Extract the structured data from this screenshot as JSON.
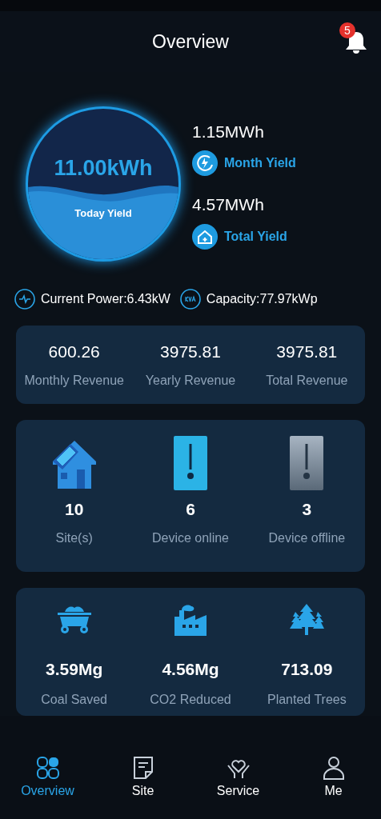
{
  "header": {
    "title": "Overview",
    "notification_count": "5"
  },
  "today": {
    "value": "11.00kWh",
    "label": "Today Yield"
  },
  "yields": [
    {
      "kind": "month",
      "value": "1.15MWh",
      "label": "Month Yield"
    },
    {
      "kind": "total",
      "value": "4.57MWh",
      "label": "Total Yield"
    }
  ],
  "stats": [
    {
      "kind": "power",
      "text": "Current Power:6.43kW"
    },
    {
      "kind": "capacity",
      "text": "Capacity:77.97kWp"
    }
  ],
  "revenue": [
    {
      "value": "600.26",
      "label": "Monthly Revenue"
    },
    {
      "value": "3975.81",
      "label": "Yearly Revenue"
    },
    {
      "value": "3975.81",
      "label": "Total Revenue"
    }
  ],
  "devices": [
    {
      "kind": "site",
      "value": "10",
      "label": "Site(s)"
    },
    {
      "kind": "online",
      "value": "6",
      "label": "Device online"
    },
    {
      "kind": "offline",
      "value": "3",
      "label": "Device offline"
    }
  ],
  "environment": [
    {
      "kind": "coal",
      "value": "3.59Mg",
      "label": "Coal Saved"
    },
    {
      "kind": "co2",
      "value": "4.56Mg",
      "label": "CO2 Reduced"
    },
    {
      "kind": "trees",
      "value": "713.09",
      "label": "Planted Trees"
    }
  ],
  "tabs": [
    {
      "kind": "overview",
      "label": "Overview",
      "selected": true
    },
    {
      "kind": "site",
      "label": "Site",
      "selected": false
    },
    {
      "kind": "service",
      "label": "Service",
      "selected": false
    },
    {
      "kind": "me",
      "label": "Me",
      "selected": false
    }
  ]
}
